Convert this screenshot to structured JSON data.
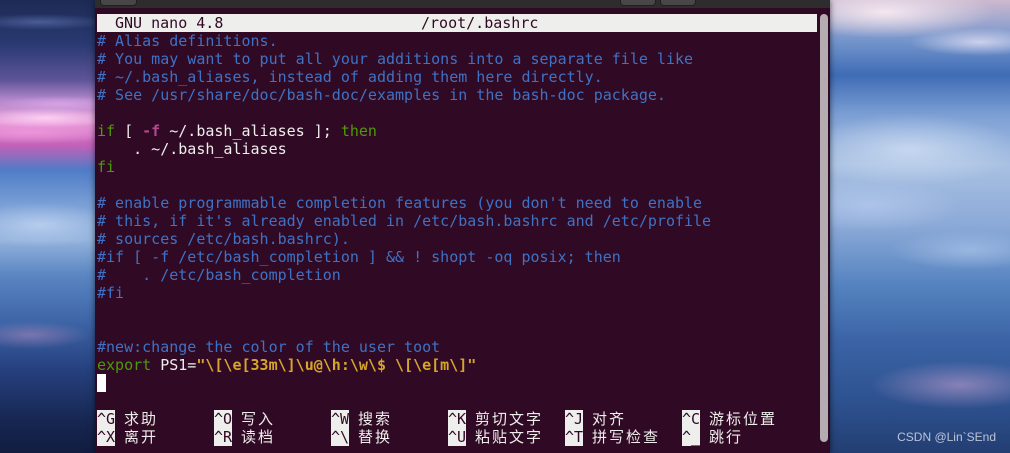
{
  "titlebar": {
    "program": "GNU nano 4.8",
    "filename": "/root/.bashrc"
  },
  "editor": {
    "lines": [
      [
        "# Alias definitions."
      ],
      [
        "# You may want to put all your additions into a separate file like"
      ],
      [
        "# ~/.bash_aliases, instead of adding them here directly."
      ],
      [
        "# See /usr/share/doc/bash-doc/examples in the bash-doc package."
      ],
      [],
      [
        "if",
        " [ ",
        "-f",
        " ~/.bash_aliases ]; ",
        "then"
      ],
      [
        "    . ~/.bash_aliases"
      ],
      [
        "fi"
      ],
      [],
      [
        "# enable programmable completion features (you don't need to enable"
      ],
      [
        "# this, if it's already enabled in /etc/bash.bashrc and /etc/profile"
      ],
      [
        "# sources /etc/bash.bashrc)."
      ],
      [
        "#if [ -f /etc/bash_completion ] && ! shopt -oq posix; then"
      ],
      [
        "#    . /etc/bash_completion"
      ],
      [
        "#fi"
      ],
      [],
      [],
      [
        "#new:change the color of the user toot"
      ],
      [
        "export",
        " PS1=",
        "\"\\[\\e[33m\\]\\u@\\h:\\w\\$ \\[\\e[m\\]\""
      ]
    ]
  },
  "shortcuts": {
    "row1": [
      {
        "key": "^G",
        "label": "求助"
      },
      {
        "key": "^O",
        "label": "写入"
      },
      {
        "key": "^W",
        "label": "搜索"
      },
      {
        "key": "^K",
        "label": "剪切文字"
      },
      {
        "key": "^J",
        "label": "对齐"
      },
      {
        "key": "^C",
        "label": "游标位置"
      }
    ],
    "row2": [
      {
        "key": "^X",
        "label": "离开"
      },
      {
        "key": "^R",
        "label": "读档"
      },
      {
        "key": "^\\",
        "label": "替换"
      },
      {
        "key": "^U",
        "label": "粘贴文字"
      },
      {
        "key": "^T",
        "label": "拼写检查"
      },
      {
        "key": "^_",
        "label": "跳行"
      }
    ]
  },
  "watermark": "CSDN @Lin`SEnd",
  "colors": {
    "terminal_bg": "#300a24",
    "text": "#eeeeec",
    "comment": "#3f72c4",
    "keyword": "#4e9a06",
    "option": "#b0498e",
    "string": "#d7a52c",
    "bar": "#eeeeec"
  }
}
